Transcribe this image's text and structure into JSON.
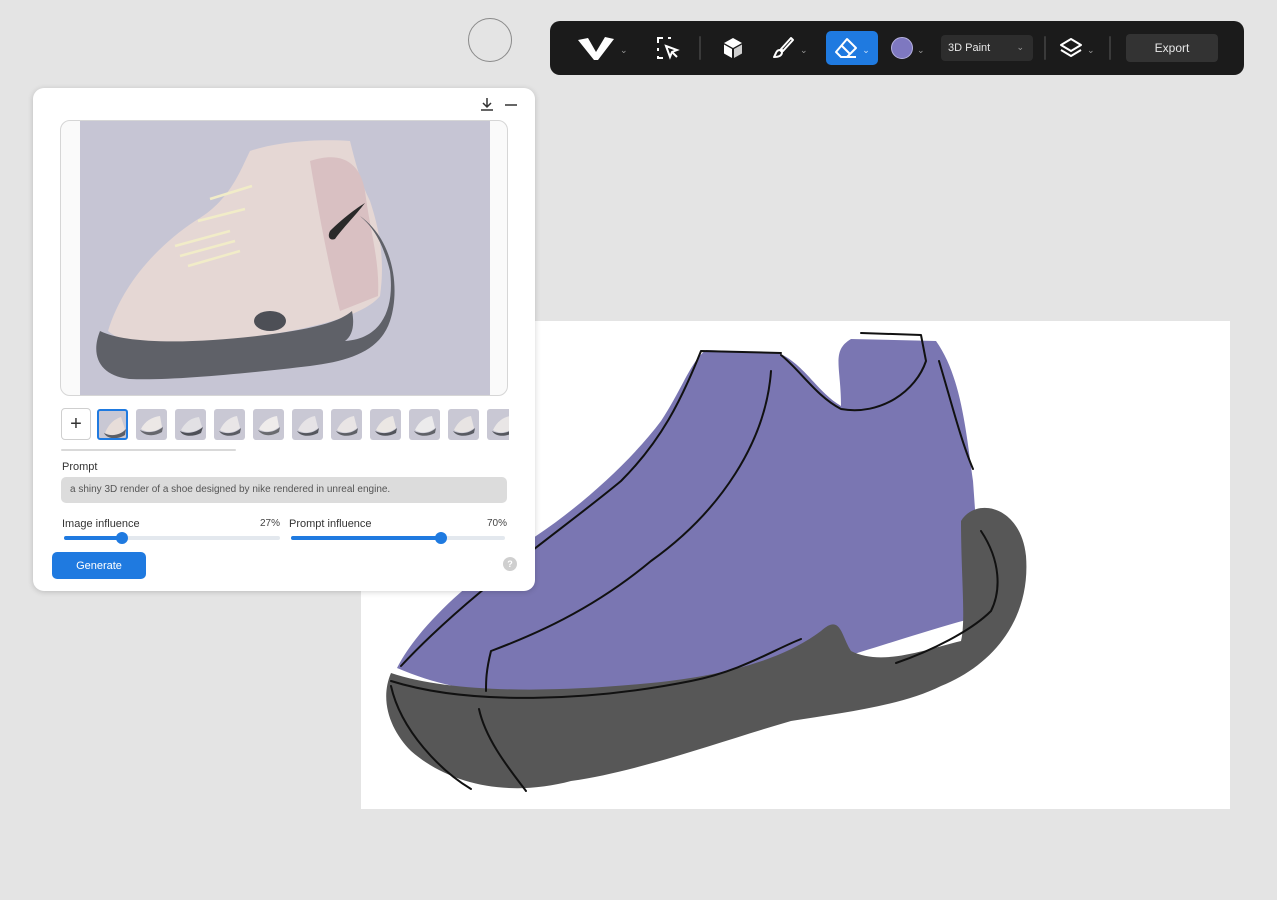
{
  "toolbar": {
    "logo_icon": "v-logo-icon",
    "mode_label": "3D Paint",
    "export_label": "Export",
    "active_tool": "eraser",
    "brush_color": "#7e78c0",
    "accent_color": "#1f7ae0"
  },
  "panel": {
    "download_icon": "download-icon",
    "minimize_icon": "minimize-icon",
    "add_thumb_label": "+",
    "thumbnail_count": 11,
    "prompt_label": "Prompt",
    "prompt_value": "a shiny 3D render of a shoe designed by nike rendered in unreal engine.",
    "image_influence": {
      "label": "Image influence",
      "value_label": "27%",
      "value": 27
    },
    "prompt_influence": {
      "label": "Prompt influence",
      "value_label": "70%",
      "value": 70
    },
    "generate_label": "Generate",
    "help_label": "?"
  },
  "canvas": {
    "sketch_body_color": "#7a76b2",
    "sketch_sole_color": "#575757"
  }
}
